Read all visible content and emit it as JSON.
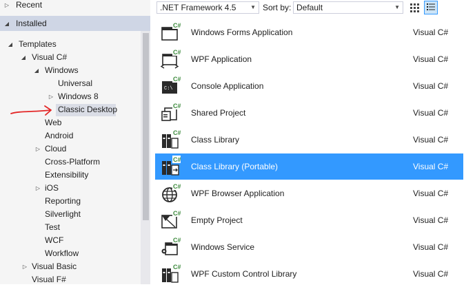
{
  "tree": {
    "recent": "Recent",
    "installed": "Installed",
    "templates": "Templates",
    "visual_csharp": "Visual C#",
    "windows": "Windows",
    "universal": "Universal",
    "windows8": "Windows 8",
    "classic_desktop": "Classic Desktop",
    "web": "Web",
    "android": "Android",
    "cloud": "Cloud",
    "cross_platform": "Cross-Platform",
    "extensibility": "Extensibility",
    "ios": "iOS",
    "reporting": "Reporting",
    "silverlight": "Silverlight",
    "test": "Test",
    "wcf": "WCF",
    "workflow": "Workflow",
    "visual_basic": "Visual Basic",
    "visual_fsharp": "Visual F#"
  },
  "toolbar": {
    "framework": ".NET Framework 4.5",
    "sort_label": "Sort by:",
    "sort_value": "Default"
  },
  "templates": [
    {
      "name": "Windows Forms Application",
      "lang": "Visual C#",
      "icon": "winforms-icon"
    },
    {
      "name": "WPF Application",
      "lang": "Visual C#",
      "icon": "wpf-icon"
    },
    {
      "name": "Console Application",
      "lang": "Visual C#",
      "icon": "console-icon"
    },
    {
      "name": "Shared Project",
      "lang": "Visual C#",
      "icon": "shared-project-icon"
    },
    {
      "name": "Class Library",
      "lang": "Visual C#",
      "icon": "class-library-icon"
    },
    {
      "name": "Class Library (Portable)",
      "lang": "Visual C#",
      "icon": "portable-library-icon",
      "selected": true
    },
    {
      "name": "WPF Browser Application",
      "lang": "Visual C#",
      "icon": "wpf-browser-icon"
    },
    {
      "name": "Empty Project",
      "lang": "Visual C#",
      "icon": "empty-project-icon"
    },
    {
      "name": "Windows Service",
      "lang": "Visual C#",
      "icon": "windows-service-icon"
    },
    {
      "name": "WPF Custom Control Library",
      "lang": "Visual C#",
      "icon": "wpf-control-library-icon"
    }
  ]
}
